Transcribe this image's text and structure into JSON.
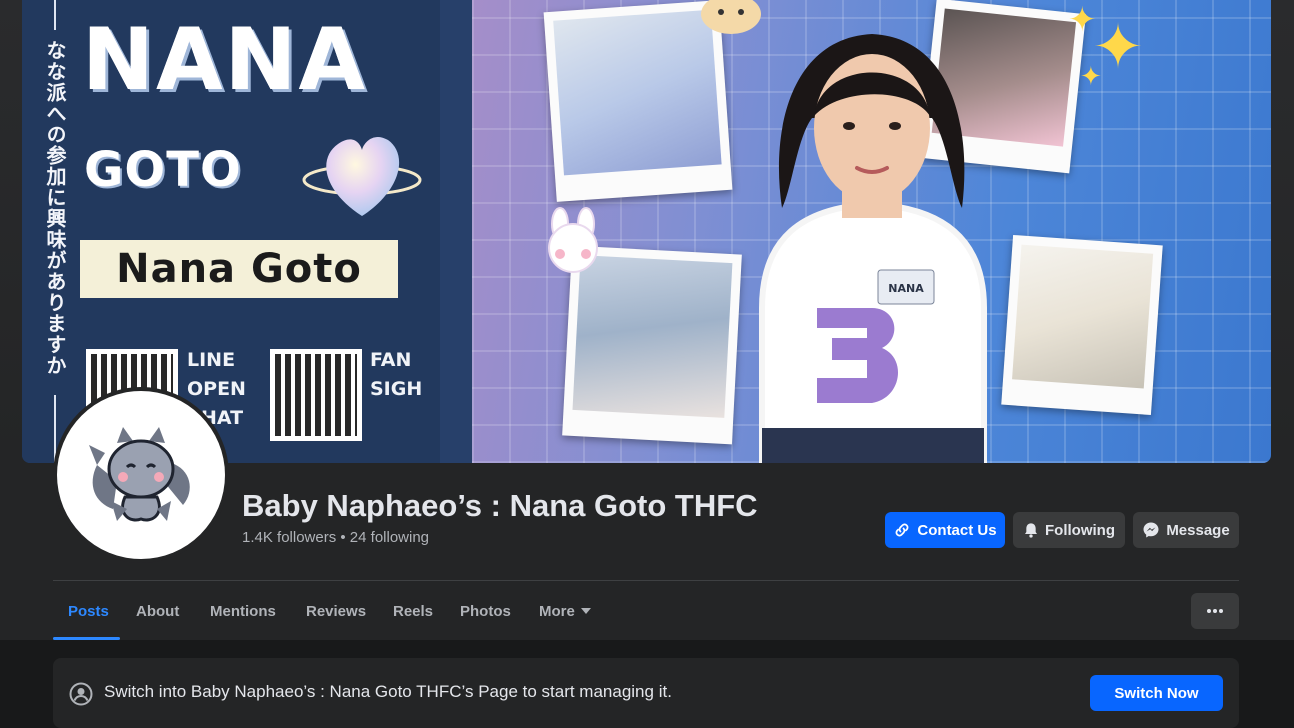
{
  "cover": {
    "title_big": "NANA",
    "subtitle_big": "GOTO",
    "name_box": "Nana  Goto",
    "vertical_text": "なな派への参加に興味がありますか",
    "qr1_label": "LINE\nOPEN\nCHAT",
    "qr2_label": "FAN\nSIGH",
    "badge_text": "NANA"
  },
  "profile": {
    "page_name": "Baby Naphaeo’s : Nana Goto THFC",
    "followers_text": "1.4K followers • 24 following"
  },
  "actions": {
    "contact_label": "Contact Us",
    "following_label": "Following",
    "message_label": "Message"
  },
  "tabs": [
    {
      "label": "Posts"
    },
    {
      "label": "About"
    },
    {
      "label": "Mentions"
    },
    {
      "label": "Reviews"
    },
    {
      "label": "Reels"
    },
    {
      "label": "Photos"
    },
    {
      "label": "More"
    }
  ],
  "banner": {
    "text": "Switch into Baby Naphaeo’s : Nana Goto THFC’s Page to start managing it.",
    "button_label": "Switch Now"
  },
  "colors": {
    "accent": "#0866ff",
    "tab_active": "#2d88ff",
    "background": "#18191a",
    "surface": "#242526",
    "secondary_button": "#3a3b3c"
  },
  "icons": [
    "link-icon",
    "bell-icon",
    "messenger-icon",
    "chevron-down-icon",
    "more-dots-icon",
    "switch-profile-icon"
  ]
}
